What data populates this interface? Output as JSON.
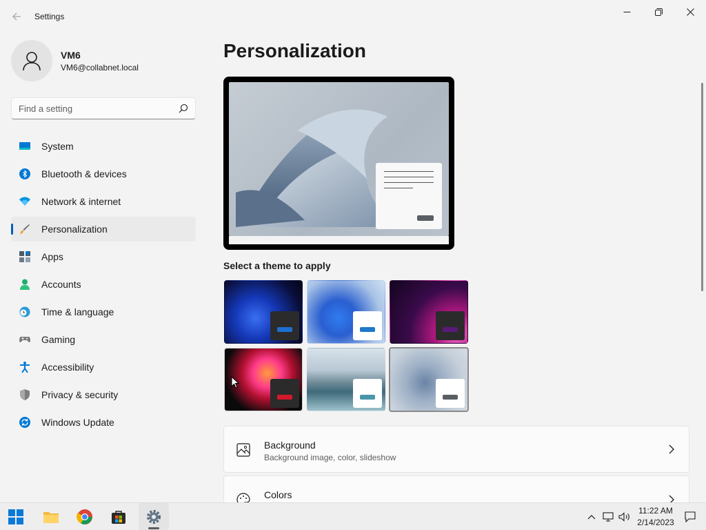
{
  "window": {
    "title": "Settings",
    "back_icon": "back-arrow-icon",
    "controls": [
      "minimize-icon",
      "maximize-icon",
      "close-icon"
    ]
  },
  "user": {
    "name": "VM6",
    "email": "VM6@collabnet.local",
    "avatar_icon": "person-icon"
  },
  "search": {
    "placeholder": "Find a setting",
    "value": ""
  },
  "sidebar": {
    "items": [
      {
        "label": "System",
        "icon": "system-display-icon"
      },
      {
        "label": "Bluetooth & devices",
        "icon": "bluetooth-icon"
      },
      {
        "label": "Network & internet",
        "icon": "wifi-icon"
      },
      {
        "label": "Personalization",
        "icon": "brush-icon",
        "active": true
      },
      {
        "label": "Apps",
        "icon": "apps-icon"
      },
      {
        "label": "Accounts",
        "icon": "accounts-icon"
      },
      {
        "label": "Time & language",
        "icon": "clock-globe-icon"
      },
      {
        "label": "Gaming",
        "icon": "gamepad-icon"
      },
      {
        "label": "Accessibility",
        "icon": "accessibility-icon"
      },
      {
        "label": "Privacy & security",
        "icon": "shield-icon"
      },
      {
        "label": "Windows Update",
        "icon": "update-icon"
      }
    ]
  },
  "main": {
    "title": "Personalization",
    "themes_label": "Select a theme to apply",
    "themes": [
      {
        "name": "windows-dark-bloom",
        "accent": "#1e6fd0",
        "swatch": "#2b2b2b"
      },
      {
        "name": "windows-light-bloom",
        "accent": "#1e78c8",
        "swatch": "#ffffff"
      },
      {
        "name": "glow",
        "accent": "#5a1a7a",
        "swatch": "#2b2b2b"
      },
      {
        "name": "captured-motion",
        "accent": "#d11a2a",
        "swatch": "#2b2b2b"
      },
      {
        "name": "sunrise-flow",
        "accent": "#4a96a8",
        "swatch": "#ffffff"
      },
      {
        "name": "windows-light-default",
        "accent": "#5a5f65",
        "swatch": "#ffffff",
        "selected": true
      }
    ],
    "cards": [
      {
        "title": "Background",
        "subtitle": "Background image, color, slideshow",
        "icon": "image-icon"
      },
      {
        "title": "Colors",
        "subtitle": "",
        "icon": "palette-icon"
      }
    ]
  },
  "taskbar": {
    "apps": [
      {
        "name": "start-icon"
      },
      {
        "name": "file-explorer-icon"
      },
      {
        "name": "chrome-icon"
      },
      {
        "name": "store-icon"
      },
      {
        "name": "settings-gear-icon",
        "active": true
      }
    ],
    "tray": {
      "chevron": "chevron-up-icon",
      "network": "network-icon",
      "volume": "volume-icon",
      "notifications": "notification-icon"
    },
    "time": "11:22 AM",
    "date": "2/14/2023"
  },
  "colors": {
    "accent": "#005fb8",
    "background": "#f3f3f3"
  }
}
